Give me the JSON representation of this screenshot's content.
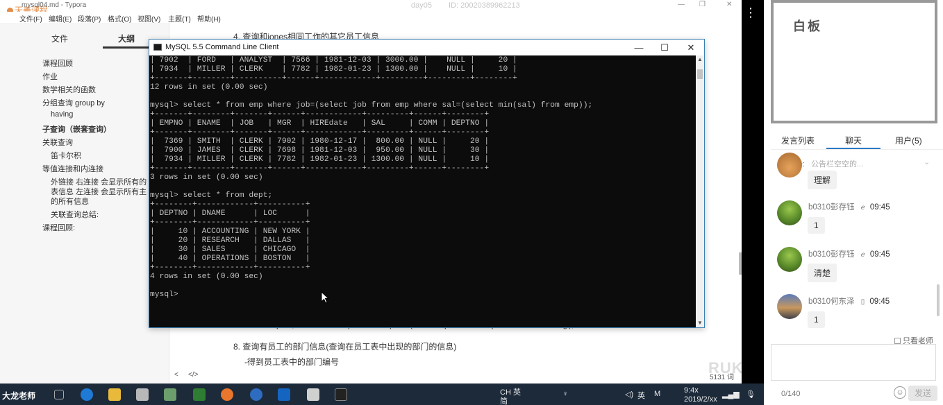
{
  "typora": {
    "window_title": "mysql04.md - Typora",
    "watermark": "天善课程",
    "course_label": "day05",
    "id_label": "ID: 20020389962213",
    "menu": [
      "文件(F)",
      "编辑(E)",
      "段落(P)",
      "格式(O)",
      "视图(V)",
      "主题(T)",
      "帮助(H)"
    ],
    "sidebar_tabs": [
      "文件",
      "大纲"
    ],
    "outline": [
      "课程回顾",
      "作业",
      "数学相关的函数",
      "分组查询 group by",
      "having",
      "子查询（嵌套查询）",
      "关联查询",
      "笛卡尔积",
      "等值连接和内连接",
      "外链接 右连接 会显示所有的",
      "表信息 左连接 会显示所有主",
      "的所有信息",
      "关联查询总结:",
      "课程回顾:"
    ],
    "doc_top": "4. 查询和jones相同工作的其它员工信息",
    "doc_hidden": "select deptno,dname from dept where deptno=(select deptno from emp where ename='king');",
    "doc_item8": "8. 查询有员工的部门信息(查询在员工表中出现的部门的信息)",
    "doc_item8_sub": "-得到员工表中的部门编号",
    "status_left": "<",
    "status_code": "</>",
    "word_count": "5131 词",
    "ruka": "RUKA"
  },
  "console": {
    "title": "MySQL 5.5 Command Line Client",
    "lines": [
      "| 7902  | FORD   | ANALYST  | 7566 | 1981-12-03 | 3000.00 |    NULL |     20 |",
      "| 7934  | MILLER | CLERK    | 7782 | 1982-01-23 | 1300.00 |    NULL |     10 |",
      "+-------+--------+----------+------+------------+---------+---------+--------+",
      "12 rows in set (0.00 sec)",
      "",
      "mysql> select * from emp where job=(select job from emp where sal=(select min(sal) from emp));",
      "+-------+--------+-------+------+------------+---------+------+--------+",
      "| EMPNO | ENAME  | JOB   | MGR  | HIREdate   | SAL     | COMM | DEPTNO |",
      "+-------+--------+-------+------+------------+---------+------+--------+",
      "|  7369 | SMITH  | CLERK | 7902 | 1980-12-17 |  800.00 | NULL |     20 |",
      "|  7900 | JAMES  | CLERK | 7698 | 1981-12-03 |  950.00 | NULL |     30 |",
      "|  7934 | MILLER | CLERK | 7782 | 1982-01-23 | 1300.00 | NULL |     10 |",
      "+-------+--------+-------+------+------------+---------+------+--------+",
      "3 rows in set (0.00 sec)",
      "",
      "mysql> select * from dept;",
      "+--------+------------+----------+",
      "| DEPTNO | DNAME      | LOC      |",
      "+--------+------------+----------+",
      "|     10 | ACCOUNTING | NEW YORK |",
      "|     20 | RESEARCH   | DALLAS   |",
      "|     30 | SALES      | CHICAGO  |",
      "|     40 | OPERATIONS | BOSTON   |",
      "+--------+------------+----------+",
      "4 rows in set (0.00 sec)",
      "",
      "mysql>"
    ]
  },
  "taskbar": {
    "user_label": "大龙老师",
    "tray_ime": "CH 英",
    "tray_ime2": "简",
    "tray_lang": "英",
    "tray_time": "9:4x",
    "tray_date": "2019/2/xx"
  },
  "right_panel": {
    "whiteboard_title": "白板",
    "tabs": [
      "发言列表",
      "聊天",
      "用户(5)"
    ],
    "notice_label": "公告:",
    "notice_text": "公告栏空空的...",
    "messages": [
      {
        "name": "",
        "time": "",
        "text": "理解",
        "avatar": "orange"
      },
      {
        "name": "b0310彭存钰",
        "time": "09:45",
        "text": "1",
        "avatar": "green",
        "device": "ie-icon"
      },
      {
        "name": "b0310彭存钰",
        "time": "09:45",
        "text": "清楚",
        "avatar": "green",
        "device": "ie-icon"
      },
      {
        "name": "b0310何东泽",
        "time": "09:45",
        "text": "1",
        "avatar": "city",
        "device": "phone-icon"
      }
    ],
    "only_teacher_label": "只看老师",
    "char_count": "0/140",
    "send_label": "发送"
  }
}
